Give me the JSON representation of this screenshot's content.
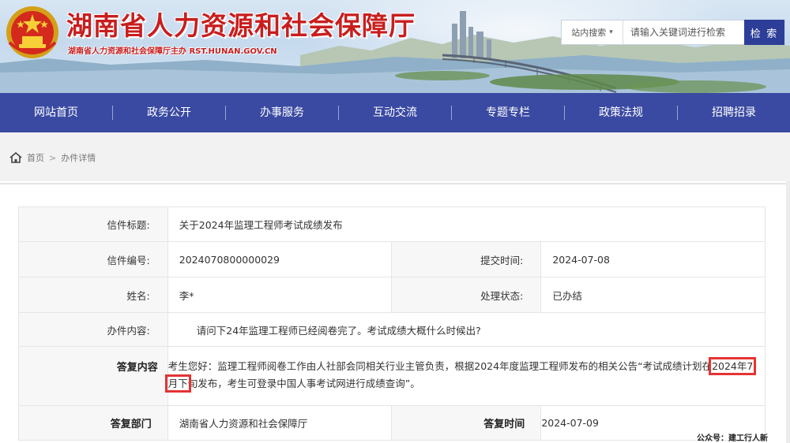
{
  "header": {
    "site_title": "湖南省人力资源和社会保障厅",
    "site_subtitle": "湖南省人力资源和社会保障厅主办  RST.HUNAN.GOV.CN"
  },
  "search": {
    "scope_label": "站内搜索",
    "placeholder": "请输入关键词进行检索",
    "button_label": "检 索"
  },
  "nav": {
    "items": [
      "网站首页",
      "政务公开",
      "办事服务",
      "互动交流",
      "专题专栏",
      "政策法规",
      "招聘招录"
    ]
  },
  "breadcrumb": {
    "home": "首页",
    "separator": ">",
    "current": "办件详情"
  },
  "letter": {
    "title_label": "信件标题:",
    "title": "关于2024年监理工程师考试成绩发布",
    "number_label": "信件编号:",
    "number": "2024070800000029",
    "submit_time_label": "提交时间:",
    "submit_time": "2024-07-08",
    "name_label": "姓名:",
    "name": "李*",
    "status_label": "处理状态:",
    "status": "已办结",
    "content_label": "办件内容:",
    "content": "请问下24年监理工程师已经阅卷完了。考试成绩大概什么时候出?",
    "reply_label": "答复内容",
    "reply_part1": "考生您好：监理工程师阅卷工作由人社部会同相关行业主管负责，根据2024年度监理工程师发布的相关公告“考试成绩计划在",
    "reply_highlight": "2024年7月下",
    "reply_part2": "旬发布，考生可登录中国人事考试网进行成绩查询”。",
    "dept_label": "答复部门",
    "dept": "湖南省人力资源和社会保障厅",
    "reply_time_label": "答复时间",
    "reply_time": "2024-07-09"
  },
  "watermark": "公众号：建工行人新",
  "colors": {
    "nav_bg": "#3a4aa2",
    "title_red": "#c81e1e",
    "search_button": "#2d3e99",
    "highlight_box": "#e53333"
  },
  "icons": {
    "emblem": "national-emblem",
    "breadcrumb_home": "home-icon",
    "search_scope": "chevron-down-icon"
  }
}
